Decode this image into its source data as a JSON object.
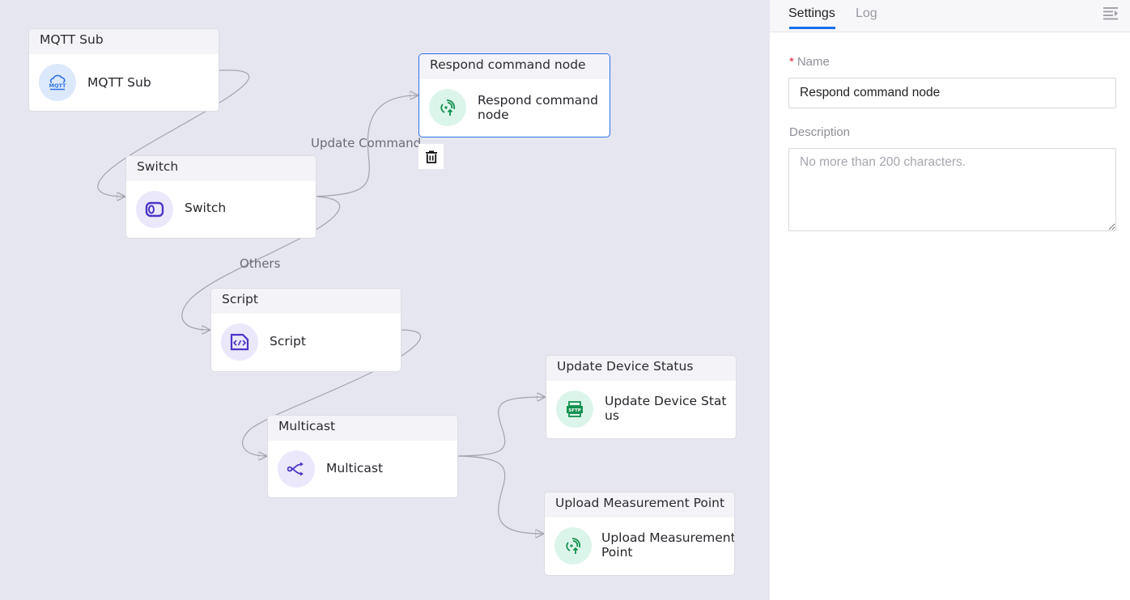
{
  "canvas": {
    "nodes": [
      {
        "id": "mqtt-sub",
        "header": "MQTT Sub",
        "label": "MQTT Sub",
        "icon": "mqtt-cloud-icon",
        "icon_color": "#2f6fe4",
        "theme": "blue",
        "selected": false
      },
      {
        "id": "switch",
        "header": "Switch",
        "label": "Switch",
        "icon": "switch-toggle-icon",
        "icon_color": "#4b36c8",
        "theme": "purple",
        "selected": false
      },
      {
        "id": "respond-command-node",
        "header": "Respond command node",
        "label": "Respond command node",
        "icon": "signal-upload-icon",
        "icon_color": "#12904e",
        "theme": "green",
        "selected": true
      },
      {
        "id": "script",
        "header": "Script",
        "label": "Script",
        "icon": "code-file-icon",
        "icon_color": "#4b36c8",
        "theme": "purple",
        "selected": false
      },
      {
        "id": "multicast",
        "header": "Multicast",
        "label": "Multicast",
        "icon": "multicast-branch-icon",
        "icon_color": "#4b36c8",
        "theme": "purple",
        "selected": false
      },
      {
        "id": "update-device-status",
        "header": "Update Device Status",
        "label": "Update Device Status",
        "icon": "sftp-icon",
        "icon_color": "#12904e",
        "theme": "green",
        "selected": false
      },
      {
        "id": "upload-measurement-point",
        "header": "Upload Measurement Point",
        "label": "Upload Measurement Point",
        "icon": "signal-upload-icon",
        "icon_color": "#12904e",
        "theme": "green",
        "selected": false
      }
    ],
    "edges": [
      {
        "from": "mqtt-sub",
        "to": "switch",
        "label": ""
      },
      {
        "from": "switch",
        "to": "respond-command-node",
        "label": "Update Command"
      },
      {
        "from": "switch",
        "to": "script",
        "label": "Others"
      },
      {
        "from": "script",
        "to": "multicast",
        "label": ""
      },
      {
        "from": "multicast",
        "to": "update-device-status",
        "label": ""
      },
      {
        "from": "multicast",
        "to": "upload-measurement-point",
        "label": ""
      }
    ],
    "edge_labels": {
      "update_command": "Update Command",
      "others": "Others"
    },
    "delete_button_icon": "trash-icon"
  },
  "panel": {
    "tabs": [
      {
        "label": "Settings",
        "active": true
      },
      {
        "label": "Log",
        "active": false
      }
    ],
    "collapse_icon": "collapse-panel-icon",
    "accent_color": "#1a6ef0",
    "form": {
      "name_label": "Name",
      "name_required_mark": "*",
      "name_value": "Respond command node",
      "description_label": "Description",
      "description_value": "",
      "description_placeholder": "No more than 200 characters."
    }
  }
}
